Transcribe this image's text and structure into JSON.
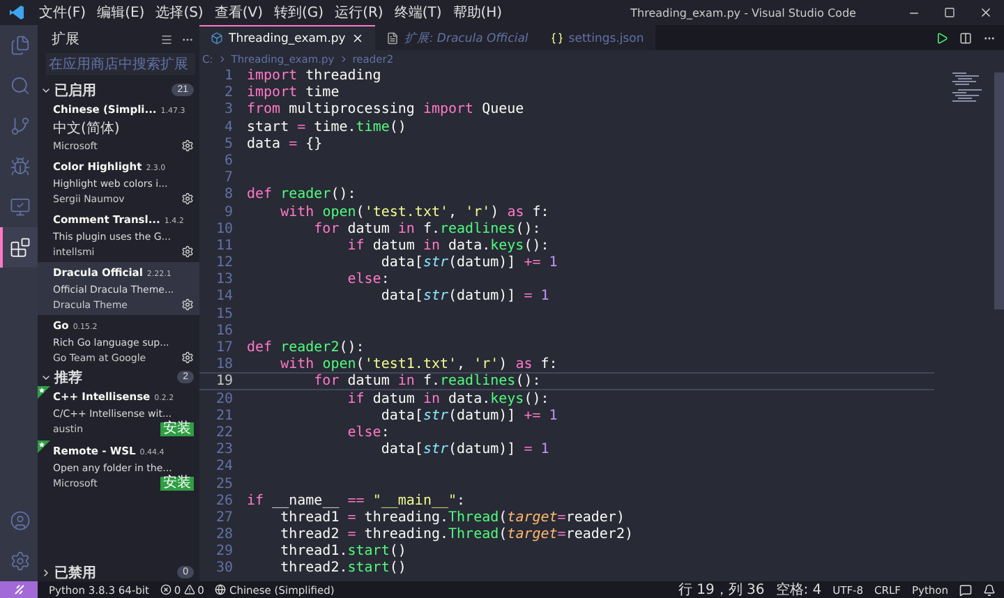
{
  "window": {
    "title": "Threading_exam.py - Visual Studio Code"
  },
  "menu": [
    "文件(F)",
    "编辑(E)",
    "选择(S)",
    "查看(V)",
    "转到(G)",
    "运行(R)",
    "终端(T)",
    "帮助(H)"
  ],
  "activity_bar": [
    {
      "kind": "explorer",
      "selected": false
    },
    {
      "kind": "search",
      "selected": false
    },
    {
      "kind": "scm",
      "selected": false
    },
    {
      "kind": "debug",
      "selected": false
    },
    {
      "kind": "remote",
      "selected": false
    },
    {
      "kind": "extensions",
      "selected": true
    }
  ],
  "activity_bar_bottom": [
    {
      "kind": "account"
    },
    {
      "kind": "settings"
    }
  ],
  "sidebar": {
    "title": "扩展",
    "search": {
      "placeholder": "在应用商店中搜索扩展"
    },
    "sections": [
      {
        "label": "已启用",
        "count": "21",
        "expanded": true,
        "items": [
          {
            "name": "Chinese (Simpli...",
            "version": "1.47.3",
            "description": "中文(简体)",
            "publisher": "Microsoft",
            "selected": false,
            "recommended": false
          },
          {
            "name": "Color Highlight",
            "version": "2.3.0",
            "description": "Highlight web colors i...",
            "publisher": "Sergii Naumov",
            "selected": false,
            "recommended": false
          },
          {
            "name": "Comment Transl...",
            "version": "1.4.2",
            "description": "This plugin uses the G...",
            "publisher": "intellsmi",
            "selected": false,
            "recommended": false
          },
          {
            "name": "Dracula Official",
            "version": "2.22.1",
            "description": "Official Dracula Theme...",
            "publisher": "Dracula Theme",
            "selected": true,
            "recommended": false
          },
          {
            "name": "Go",
            "version": "0.15.2",
            "description": "Rich Go language sup...",
            "publisher": "Go Team at Google",
            "selected": false,
            "recommended": false
          }
        ]
      },
      {
        "label": "推荐",
        "count": "2",
        "expanded": true,
        "items": [
          {
            "name": "C++ Intellisense",
            "version": "0.2.2",
            "description": "C/C++ Intellisense wit...",
            "publisher": "austin",
            "selected": false,
            "recommended": true,
            "install": "安装"
          },
          {
            "name": "Remote - WSL",
            "version": "0.44.4",
            "description": "Open any folder in the...",
            "publisher": "Microsoft",
            "selected": false,
            "recommended": true,
            "install": "安装"
          }
        ]
      },
      {
        "label": "已禁用",
        "count": "0",
        "expanded": false
      }
    ]
  },
  "tabs": [
    {
      "label": "Threading_exam.py",
      "kind": "python",
      "selected": true,
      "preview": false
    },
    {
      "label": "扩展: Dracula Official",
      "kind": "page",
      "selected": false,
      "preview": true
    },
    {
      "label": "settings.json",
      "kind": "json",
      "selected": false,
      "preview": false
    }
  ],
  "breadcrumb": [
    "C:",
    "Threading_exam.py",
    "reader2"
  ],
  "code": [
    {
      "number": "1",
      "current": false,
      "tokens": [
        {
          "text": "import",
          "kind": "kw"
        },
        {
          "text": " threading",
          "kind": "plain"
        }
      ]
    },
    {
      "number": "2",
      "current": false,
      "tokens": [
        {
          "text": "import",
          "kind": "kw"
        },
        {
          "text": " time",
          "kind": "plain"
        }
      ]
    },
    {
      "number": "3",
      "current": false,
      "tokens": [
        {
          "text": "from",
          "kind": "kw"
        },
        {
          "text": " multiprocessing ",
          "kind": "plain"
        },
        {
          "text": "import",
          "kind": "kw"
        },
        {
          "text": " Queue",
          "kind": "plain"
        }
      ]
    },
    {
      "number": "4",
      "current": false,
      "tokens": [
        {
          "text": "start ",
          "kind": "plain"
        },
        {
          "text": "=",
          "kind": "kw"
        },
        {
          "text": " time.",
          "kind": "plain"
        },
        {
          "text": "time",
          "kind": "fn"
        },
        {
          "text": "()",
          "kind": "plain"
        }
      ]
    },
    {
      "number": "5",
      "current": false,
      "tokens": [
        {
          "text": "data ",
          "kind": "plain"
        },
        {
          "text": "=",
          "kind": "kw"
        },
        {
          "text": " {}",
          "kind": "plain"
        }
      ]
    },
    {
      "number": "6",
      "current": false
    },
    {
      "number": "7",
      "current": false
    },
    {
      "number": "8",
      "current": false,
      "tokens": [
        {
          "text": "def ",
          "kind": "kw"
        },
        {
          "text": "reader",
          "kind": "fn"
        },
        {
          "text": "():",
          "kind": "plain"
        }
      ]
    },
    {
      "number": "9",
      "current": false,
      "tokens": [
        {
          "text": "    with ",
          "kind": "kw"
        },
        {
          "text": "open",
          "kind": "fn"
        },
        {
          "text": "(",
          "kind": "plain"
        },
        {
          "text": "'test.txt'",
          "kind": "str"
        },
        {
          "text": ", ",
          "kind": "plain"
        },
        {
          "text": "'r'",
          "kind": "str"
        },
        {
          "text": ") ",
          "kind": "plain"
        },
        {
          "text": "as",
          "kind": "kw"
        },
        {
          "text": " f:",
          "kind": "plain"
        }
      ]
    },
    {
      "number": "10",
      "current": false,
      "tokens": [
        {
          "text": "        for",
          "kind": "kw"
        },
        {
          "text": " datum ",
          "kind": "plain"
        },
        {
          "text": "in",
          "kind": "kw"
        },
        {
          "text": " f.",
          "kind": "plain"
        },
        {
          "text": "readlines",
          "kind": "fn"
        },
        {
          "text": "():",
          "kind": "plain"
        }
      ]
    },
    {
      "number": "11",
      "current": false,
      "tokens": [
        {
          "text": "            if",
          "kind": "kw"
        },
        {
          "text": " datum ",
          "kind": "plain"
        },
        {
          "text": "in",
          "kind": "kw"
        },
        {
          "text": " data.",
          "kind": "plain"
        },
        {
          "text": "keys",
          "kind": "fn"
        },
        {
          "text": "():",
          "kind": "plain"
        }
      ]
    },
    {
      "number": "12",
      "current": false,
      "tokens": [
        {
          "text": "                data[",
          "kind": "plain"
        },
        {
          "text": "str",
          "kind": "builtin"
        },
        {
          "text": "(datum)] ",
          "kind": "plain"
        },
        {
          "text": "+= ",
          "kind": "kw"
        },
        {
          "text": "1",
          "kind": "num"
        }
      ]
    },
    {
      "number": "13",
      "current": false,
      "tokens": [
        {
          "text": "            else",
          "kind": "kw"
        },
        {
          "text": ":",
          "kind": "plain"
        }
      ]
    },
    {
      "number": "14",
      "current": false,
      "tokens": [
        {
          "text": "                data[",
          "kind": "plain"
        },
        {
          "text": "str",
          "kind": "builtin"
        },
        {
          "text": "(datum)] ",
          "kind": "plain"
        },
        {
          "text": "= ",
          "kind": "kw"
        },
        {
          "text": "1",
          "kind": "num"
        }
      ]
    },
    {
      "number": "15",
      "current": false
    },
    {
      "number": "16",
      "current": false
    },
    {
      "number": "17",
      "current": false,
      "tokens": [
        {
          "text": "def ",
          "kind": "kw"
        },
        {
          "text": "reader2",
          "kind": "fn"
        },
        {
          "text": "():",
          "kind": "plain"
        }
      ]
    },
    {
      "number": "18",
      "current": false,
      "tokens": [
        {
          "text": "    with ",
          "kind": "kw"
        },
        {
          "text": "open",
          "kind": "fn"
        },
        {
          "text": "(",
          "kind": "plain"
        },
        {
          "text": "'test1.txt'",
          "kind": "str"
        },
        {
          "text": ", ",
          "kind": "plain"
        },
        {
          "text": "'r'",
          "kind": "str"
        },
        {
          "text": ") ",
          "kind": "plain"
        },
        {
          "text": "as",
          "kind": "kw"
        },
        {
          "text": " f:",
          "kind": "plain"
        }
      ]
    },
    {
      "number": "19",
      "current": true,
      "tokens": [
        {
          "text": "        for",
          "kind": "kw"
        },
        {
          "text": " datum ",
          "kind": "plain"
        },
        {
          "text": "in",
          "kind": "kw"
        },
        {
          "text": " f.",
          "kind": "plain"
        },
        {
          "text": "readlines",
          "kind": "fn"
        },
        {
          "text": "():",
          "kind": "plain"
        }
      ]
    },
    {
      "number": "20",
      "current": false,
      "tokens": [
        {
          "text": "            if",
          "kind": "kw"
        },
        {
          "text": " datum ",
          "kind": "plain"
        },
        {
          "text": "in",
          "kind": "kw"
        },
        {
          "text": " data.",
          "kind": "plain"
        },
        {
          "text": "keys",
          "kind": "fn"
        },
        {
          "text": "():",
          "kind": "plain"
        }
      ]
    },
    {
      "number": "21",
      "current": false,
      "tokens": [
        {
          "text": "                data[",
          "kind": "plain"
        },
        {
          "text": "str",
          "kind": "builtin"
        },
        {
          "text": "(datum)] ",
          "kind": "plain"
        },
        {
          "text": "+= ",
          "kind": "kw"
        },
        {
          "text": "1",
          "kind": "num"
        }
      ]
    },
    {
      "number": "22",
      "current": false,
      "tokens": [
        {
          "text": "            else",
          "kind": "kw"
        },
        {
          "text": ":",
          "kind": "plain"
        }
      ]
    },
    {
      "number": "23",
      "current": false,
      "tokens": [
        {
          "text": "                data[",
          "kind": "plain"
        },
        {
          "text": "str",
          "kind": "builtin"
        },
        {
          "text": "(datum)] ",
          "kind": "plain"
        },
        {
          "text": "= ",
          "kind": "kw"
        },
        {
          "text": "1",
          "kind": "num"
        }
      ]
    },
    {
      "number": "24",
      "current": false
    },
    {
      "number": "25",
      "current": false
    },
    {
      "number": "26",
      "current": false,
      "tokens": [
        {
          "text": "if",
          "kind": "kw"
        },
        {
          "text": " __name__ ",
          "kind": "plain"
        },
        {
          "text": "== ",
          "kind": "kw"
        },
        {
          "text": "\"__main__\"",
          "kind": "str"
        },
        {
          "text": ":",
          "kind": "plain"
        }
      ]
    },
    {
      "number": "27",
      "current": false,
      "tokens": [
        {
          "text": "    thread1 ",
          "kind": "plain"
        },
        {
          "text": "=",
          "kind": "kw"
        },
        {
          "text": " threading.",
          "kind": "plain"
        },
        {
          "text": "Thread",
          "kind": "fn"
        },
        {
          "text": "(",
          "kind": "plain"
        },
        {
          "text": "target",
          "kind": "param"
        },
        {
          "text": "=",
          "kind": "kw"
        },
        {
          "text": "reader)",
          "kind": "plain"
        }
      ]
    },
    {
      "number": "28",
      "current": false,
      "tokens": [
        {
          "text": "    thread2 ",
          "kind": "plain"
        },
        {
          "text": "=",
          "kind": "kw"
        },
        {
          "text": " threading.",
          "kind": "plain"
        },
        {
          "text": "Thread",
          "kind": "fn"
        },
        {
          "text": "(",
          "kind": "plain"
        },
        {
          "text": "target",
          "kind": "param"
        },
        {
          "text": "=",
          "kind": "kw"
        },
        {
          "text": "reader2)",
          "kind": "plain"
        }
      ]
    },
    {
      "number": "29",
      "current": false,
      "tokens": [
        {
          "text": "    thread1.",
          "kind": "plain"
        },
        {
          "text": "start",
          "kind": "fn"
        },
        {
          "text": "()",
          "kind": "plain"
        }
      ]
    },
    {
      "number": "30",
      "current": false,
      "tokens": [
        {
          "text": "    thread2.",
          "kind": "plain"
        },
        {
          "text": "start",
          "kind": "fn"
        },
        {
          "text": "()",
          "kind": "plain"
        }
      ]
    }
  ],
  "status_bar": {
    "interpreter": "Python 3.8.3 64-bit",
    "errors": "0",
    "warnings": "0",
    "language_pack": "Chinese (Simplified)",
    "position": "行 19，列 36",
    "indent": "空格: 4",
    "encoding": "UTF-8",
    "eol": "CRLF",
    "mode": "Python"
  }
}
